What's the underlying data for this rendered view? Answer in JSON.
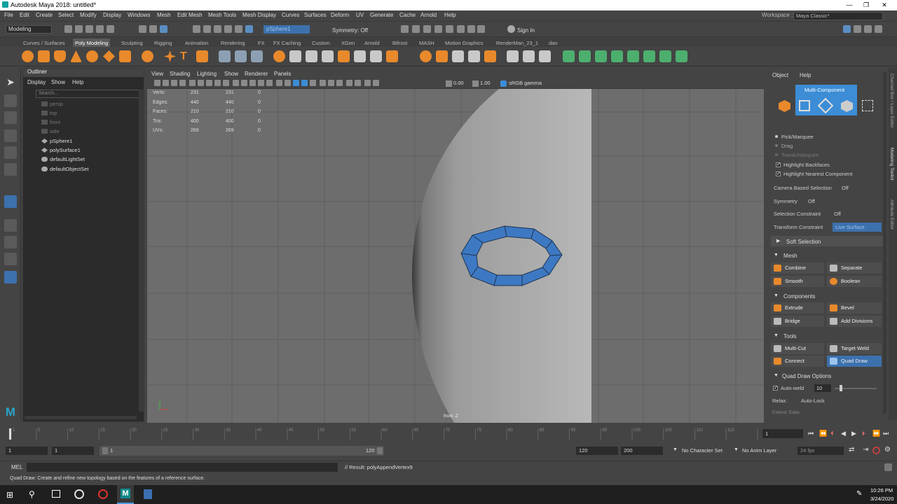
{
  "window": {
    "title": "Autodesk Maya 2018: untitled*",
    "controls": [
      "—",
      "❐",
      "✕"
    ]
  },
  "menubar": {
    "items": [
      "File",
      "Edit",
      "Create",
      "Select",
      "Modify",
      "Display",
      "Windows",
      "Mesh",
      "Edit Mesh",
      "Mesh Tools",
      "Mesh Display",
      "Curves",
      "Surfaces",
      "Deform",
      "UV",
      "Generate",
      "Cache",
      "Arnold",
      "Help"
    ],
    "workspace_label": "Workspace :",
    "workspace_value": "Maya Classic*"
  },
  "statusline": {
    "menuset": "Modeling",
    "selection_field": "pSphere1",
    "symmetry": "Symmetry: Off",
    "sign_in": "Sign In"
  },
  "shelf": {
    "tabs": [
      "Curves / Surfaces",
      "Poly Modeling",
      "Sculpting",
      "Rigging",
      "Animation",
      "Rendering",
      "FX",
      "FX Caching",
      "Custom",
      "XGen",
      "Arnold",
      "Bifrost",
      "MASH",
      "Motion Graphics",
      "RenderMan_23_1",
      "dan"
    ],
    "active_tab": "Poly Modeling"
  },
  "outliner": {
    "title": "Outliner",
    "menus": [
      "Display",
      "Show",
      "Help"
    ],
    "search_placeholder": "Search...",
    "items": [
      {
        "label": "persp",
        "dim": true
      },
      {
        "label": "top",
        "dim": true
      },
      {
        "label": "front",
        "dim": true
      },
      {
        "label": "side",
        "dim": true
      },
      {
        "label": "pSphere1",
        "dim": false
      },
      {
        "label": "polySurface1",
        "dim": false
      },
      {
        "label": "defaultLightSet",
        "dim": false
      },
      {
        "label": "defaultObjectSet",
        "dim": false
      }
    ]
  },
  "viewport": {
    "menus": [
      "View",
      "Shading",
      "Lighting",
      "Show",
      "Renderer",
      "Panels"
    ],
    "exposure": "0.00",
    "gamma": "1.00",
    "color_space": "sRGB gamma",
    "camera_label": "front -Z",
    "hud": [
      {
        "label": "Verts:",
        "a": "231",
        "b": "231",
        "c": "0"
      },
      {
        "label": "Edges:",
        "a": "440",
        "b": "440",
        "c": "0"
      },
      {
        "label": "Faces:",
        "a": "210",
        "b": "210",
        "c": "0"
      },
      {
        "label": "Tris:",
        "a": "400",
        "b": "400",
        "c": "0"
      },
      {
        "label": "UVs:",
        "a": "269",
        "b": "269",
        "c": "0"
      }
    ]
  },
  "modeling_toolkit": {
    "menus": [
      "Object",
      "Help"
    ],
    "mode_title": "Multi-Component",
    "options": {
      "pick_marquee": "Pick/Marquee",
      "drag": "Drag",
      "tweak_marquee": "Tweak/Marquee",
      "highlight_backfaces": "Highlight Backfaces",
      "highlight_nearest": "Highlight Nearest Component"
    },
    "camera_based_selection": {
      "label": "Camera Based Selection",
      "value": "Off"
    },
    "symmetry": {
      "label": "Symmetry",
      "value": "Off"
    },
    "selection_constraint": {
      "label": "Selection Constraint",
      "value": "Off"
    },
    "transform_constraint": {
      "label": "Transform Constraint",
      "value": "Live Surface"
    },
    "soft_selection": "Soft Selection",
    "mesh_section": "Mesh",
    "mesh_buttons": [
      "Combine",
      "Separate",
      "Smooth",
      "Boolean"
    ],
    "components_section": "Components",
    "component_buttons": [
      "Extrude",
      "Bevel",
      "Bridge",
      "Add Divisions"
    ],
    "tools_section": "Tools",
    "tool_buttons": [
      "Multi-Cut",
      "Target Weld",
      "Connect",
      "Quad Draw"
    ],
    "quad_draw_options": "Quad Draw Options",
    "auto_weld": {
      "label": "Auto-weld",
      "value": "10"
    },
    "relax": {
      "label": "Relax:",
      "value": "Auto-Lock"
    },
    "extend_partial": "Extend:  Edge"
  },
  "side_tabs": [
    "Channel Box / Layer Editor",
    "Modeling Toolkit",
    "Attribute Editor"
  ],
  "timeline": {
    "ticks": [
      "1",
      "5",
      "10",
      "15",
      "20",
      "25",
      "30",
      "35",
      "40",
      "45",
      "50",
      "55",
      "60",
      "65",
      "70",
      "75",
      "80",
      "85",
      "90",
      "95",
      "100",
      "105",
      "110",
      "115",
      "120"
    ],
    "current_frame": "1"
  },
  "range": {
    "start": "1",
    "inner_start": "1",
    "slider_start": "1",
    "slider_end": "120",
    "end": "120",
    "anim_end": "200",
    "character_set": "No Character Set",
    "anim_layer": "No Anim Layer",
    "fps": "24 fps"
  },
  "command_line": {
    "lang": "MEL",
    "result": "// Result: polyAppendVertex9"
  },
  "help_line": "Quad Draw: Create and refine new topology based on the features of a reference surface.",
  "taskbar": {
    "time": "10:26 PM",
    "date": "3/24/2020"
  }
}
